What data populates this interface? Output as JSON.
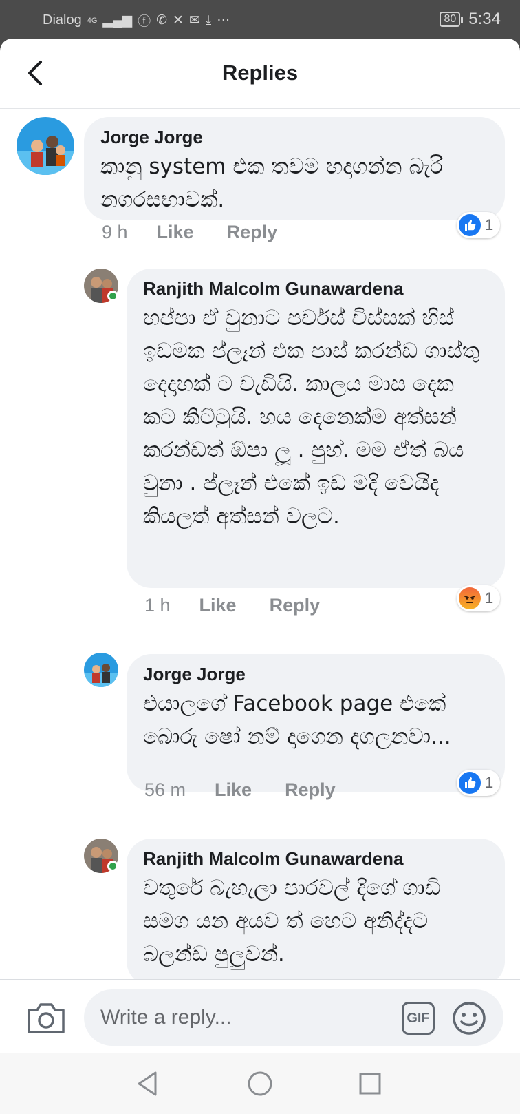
{
  "status_bar": {
    "carrier": "Dialog",
    "network": "4G",
    "battery": "80",
    "time": "5:34",
    "icons": [
      "signal-icon",
      "facebook-icon",
      "viber-icon",
      "missed-call-icon",
      "mail-icon",
      "download-icon",
      "more-icon"
    ]
  },
  "header": {
    "title": "Replies",
    "back_icon": "chevron-left-icon"
  },
  "comments": [
    {
      "author": "Jorge Jorge",
      "text": "කානු system එක තවම හදාගන්න බැරි නගරසභාවක්.",
      "time": "9 h",
      "like": "Like",
      "reply": "Reply",
      "reaction": {
        "type": "like",
        "count": "1"
      },
      "online": false
    },
    {
      "author": "Ranjith Malcolm Gunawardena",
      "text": "හප්පා ඒ වුනාට පර්චස් විස්සක් හිස් ඉඩමක ප්ලෑන් එක පාස් කරන්ඩ ගාස්තු දෙදාහක් ට වැඩියි. කාලය මාස  දෙක කට කිට්ටුයි. හය දෙනෙක්ම අත්සන් කරන්ඩත් ඕපා ලූ . පුහ්.  මම ඒත් බය වුනා . ප්ලෑන් එකේ ඉඩ මදි වෙයිද කියලත් අත්සන් වලට.",
      "time": "1 h",
      "like": "Like",
      "reply": "Reply",
      "reaction": {
        "type": "angry",
        "count": "1"
      },
      "online": true
    },
    {
      "author": "Jorge Jorge",
      "text": "එයාලගේ Facebook page එකේ බොරු ෂෝ නම් දාගෙන දගලනවා...",
      "time": "56 m",
      "like": "Like",
      "reply": "Reply",
      "reaction": {
        "type": "like",
        "count": "1"
      },
      "online": false
    },
    {
      "author": "Ranjith Malcolm Gunawardena",
      "text": "වතුරේ බැහැලා පාරවල් දිගේ ගාඩි සමග යන අයව ත් හෙට අනිද්දට බලන්ඩ පුලුවන්.",
      "online": true
    }
  ],
  "composer": {
    "placeholder": "Write a reply...",
    "gif_label": "GIF",
    "camera_icon": "camera-icon",
    "emoji_icon": "emoji-icon"
  },
  "nav": {
    "back_icon": "nav-back-icon",
    "home_icon": "nav-home-icon",
    "recents_icon": "nav-recents-icon"
  },
  "colors": {
    "like_blue": "#1877f2",
    "bubble_bg": "#f0f2f5",
    "meta_gray": "#8a8d91",
    "online_green": "#31a24c"
  }
}
